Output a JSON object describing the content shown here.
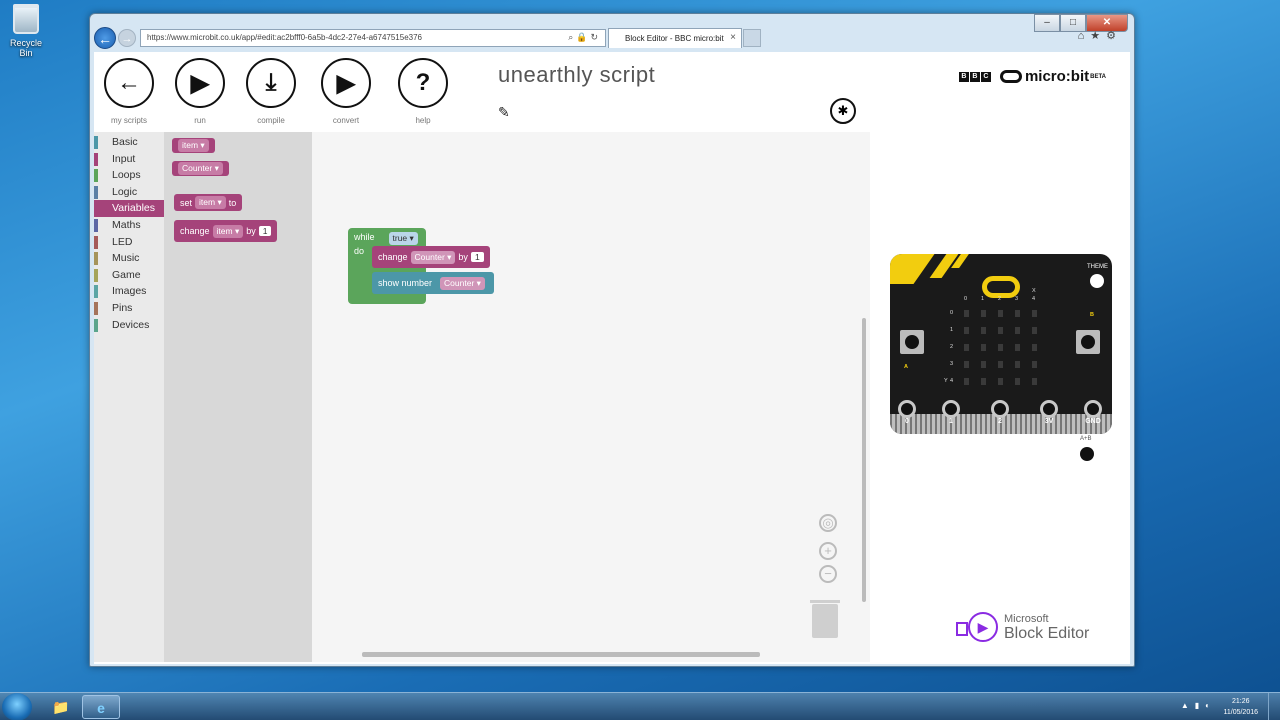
{
  "desktop": {
    "recycle_bin": "Recycle Bin"
  },
  "browser": {
    "url": "https://www.microbit.co.uk/app/#edit:ac2bfff0-6a5b-4dc2-27e4-a6747515e376",
    "tab_title": "Block Editor - BBC micro:bit",
    "controls": {
      "minimize": "–",
      "maximize": "□",
      "close": "✕"
    }
  },
  "toolbar": {
    "my_scripts": "my scripts",
    "run": "run",
    "compile": "compile",
    "convert": "convert",
    "help": "help",
    "script_title": "unearthly script"
  },
  "brand": {
    "bbc": [
      "B",
      "B",
      "C"
    ],
    "microbit": "micro:bit",
    "beta": "BETA"
  },
  "toolbox": {
    "categories": [
      {
        "label": "Basic",
        "color": "#4c97a8"
      },
      {
        "label": "Input",
        "color": "#a5437a"
      },
      {
        "label": "Loops",
        "color": "#5ba55b"
      },
      {
        "label": "Logic",
        "color": "#5b80a5"
      },
      {
        "label": "Variables",
        "color": "#a5437a",
        "selected": true
      },
      {
        "label": "Maths",
        "color": "#5b67a5"
      },
      {
        "label": "LED",
        "color": "#a55b5b"
      },
      {
        "label": "Music",
        "color": "#a5945b"
      },
      {
        "label": "Game",
        "color": "#a5a55b"
      },
      {
        "label": "Images",
        "color": "#5ba5a5"
      },
      {
        "label": "Pins",
        "color": "#a5745b"
      },
      {
        "label": "Devices",
        "color": "#5ba58c"
      }
    ]
  },
  "flyout": {
    "var_item": "item",
    "var_counter": "Counter",
    "set_label": "set",
    "set_var": "item",
    "set_to": "to",
    "change_label": "change",
    "change_var": "item",
    "change_by": "by",
    "change_value": "1"
  },
  "program": {
    "while_label": "while",
    "while_cond": "true",
    "do_label": "do",
    "change_label": "change",
    "change_var": "Counter",
    "change_by": "by",
    "change_value": "1",
    "show_label": "show number",
    "show_var": "Counter"
  },
  "simulator": {
    "theme": "THEME",
    "x_label": "X",
    "y_label": "Y",
    "cols": [
      "0",
      "1",
      "2",
      "3",
      "4"
    ],
    "rows": [
      "0",
      "1",
      "2",
      "3",
      "4"
    ],
    "btn_a": "A",
    "btn_b": "B",
    "pins": [
      "0",
      "1",
      "2",
      "3V",
      "GND"
    ],
    "ab_label": "A+B"
  },
  "ms_block_editor": {
    "line1": "Microsoft",
    "line2": "Block Editor"
  },
  "taskbar": {
    "time": "21:26",
    "date": "11/05/2016"
  }
}
